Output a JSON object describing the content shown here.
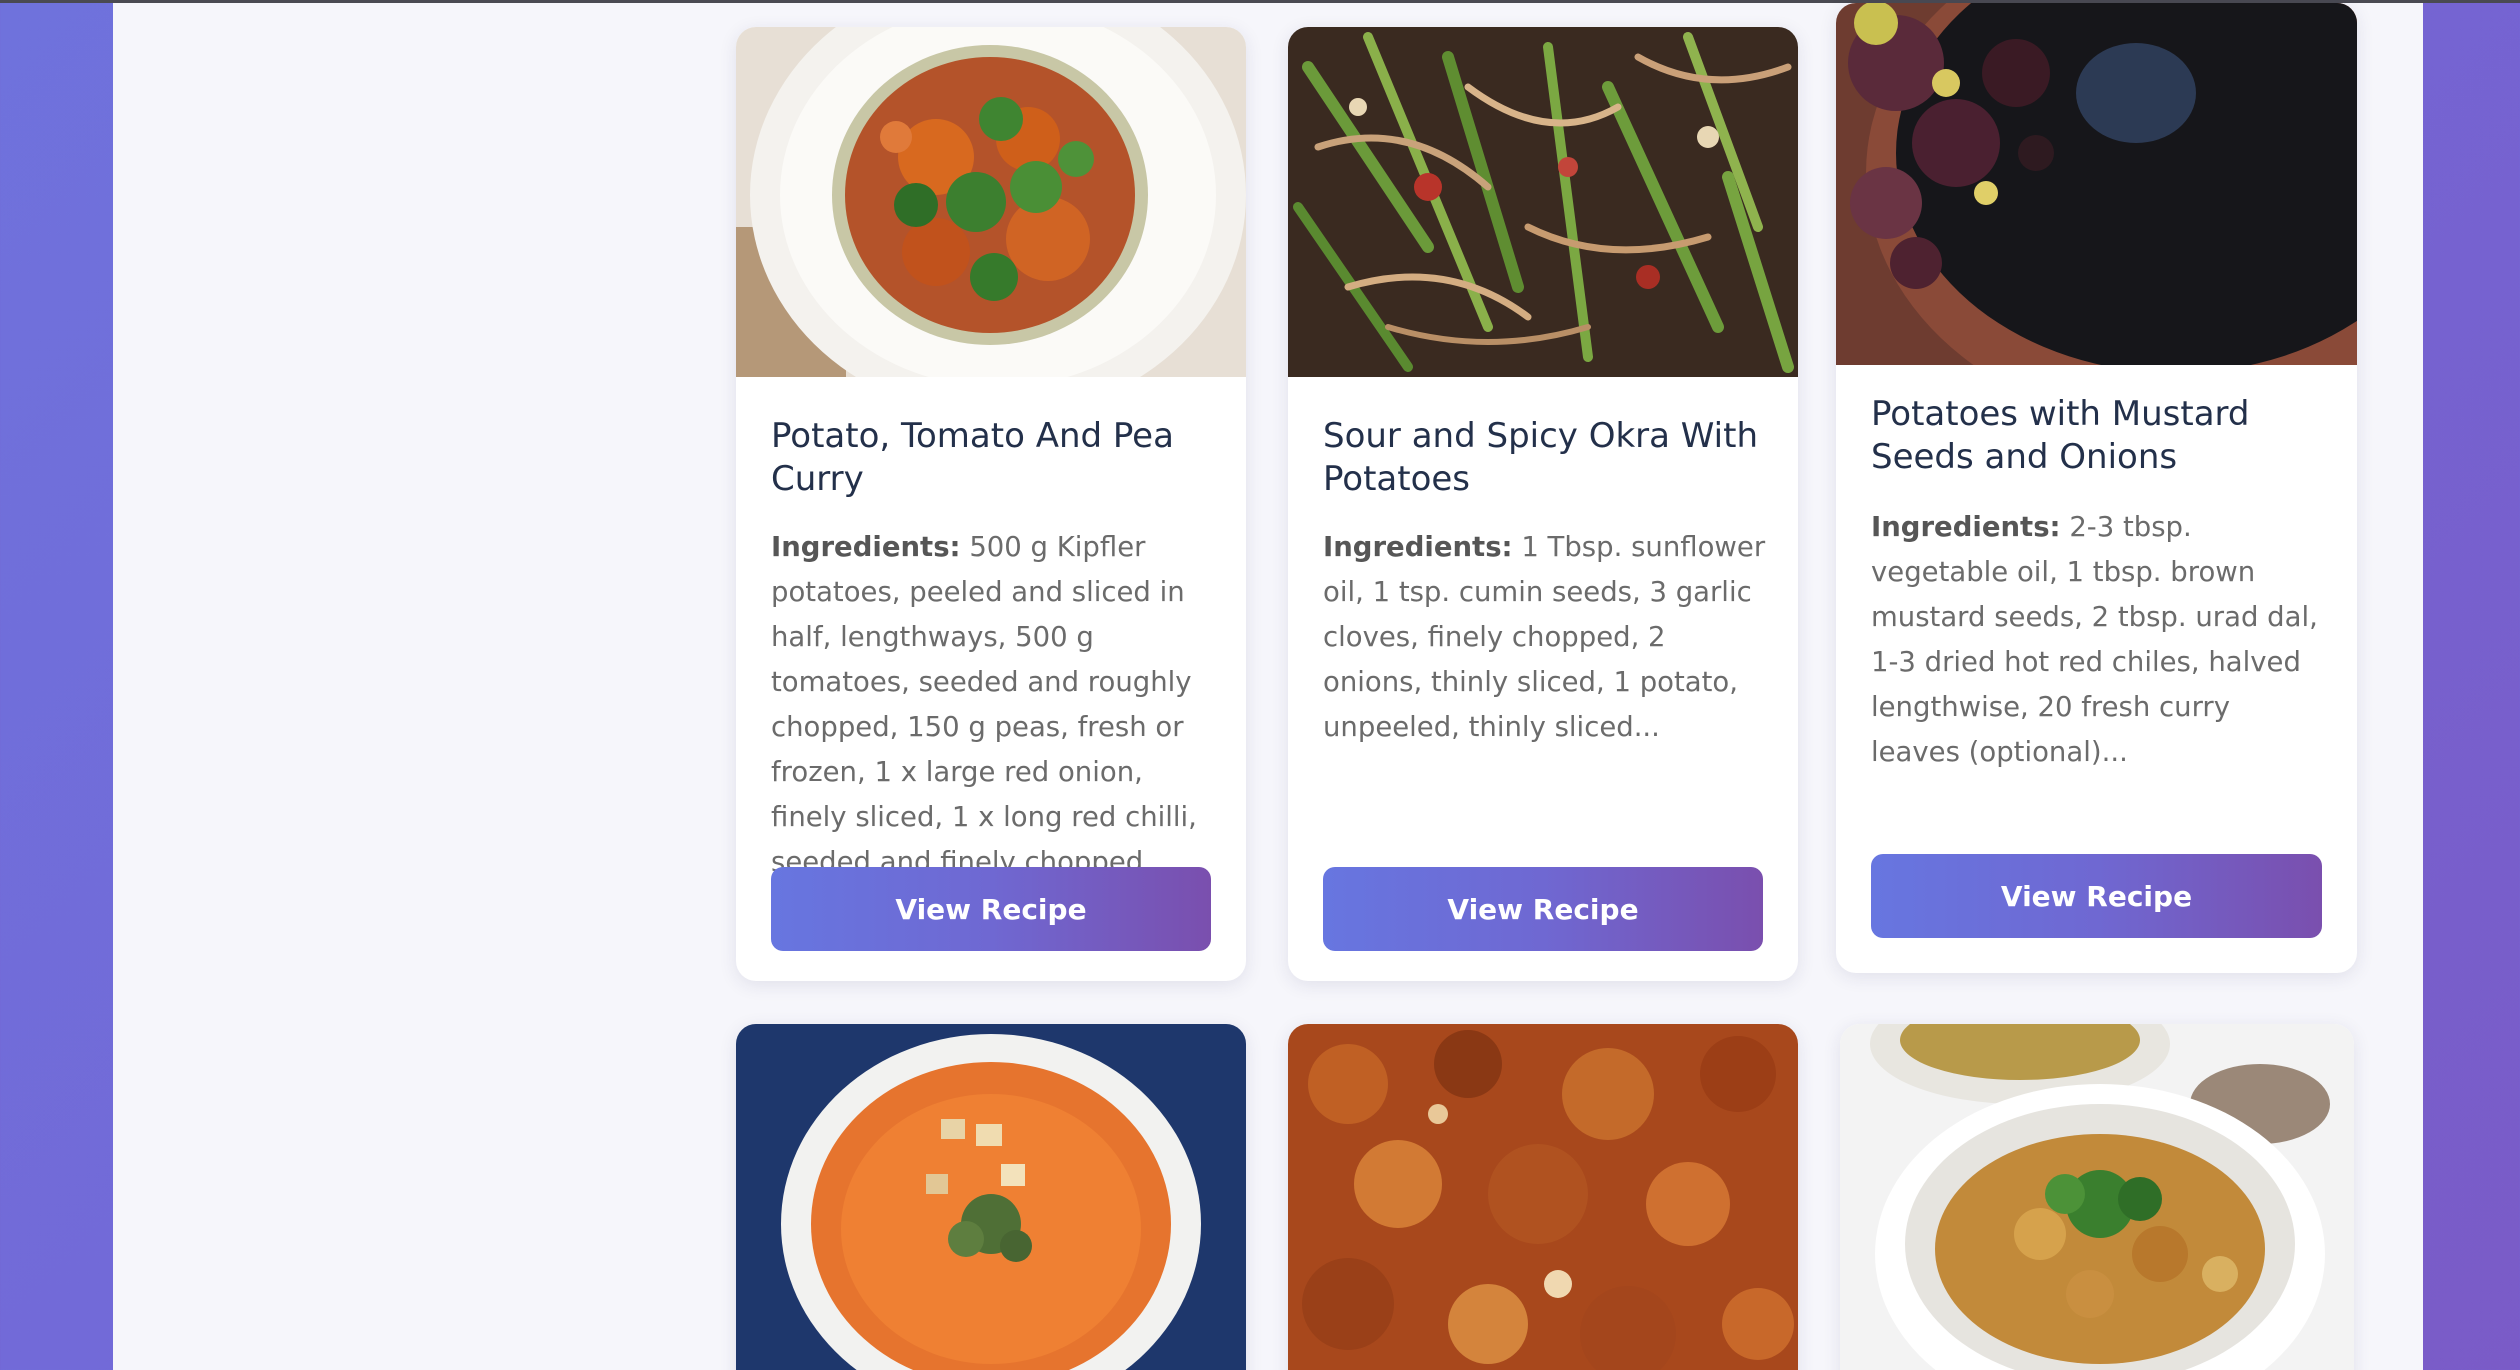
{
  "colors": {
    "page_gradient_start": "#6f72dc",
    "page_gradient_end": "#7a5bc7",
    "content_background": "#f6f6fb",
    "card_background": "#ffffff",
    "title_color": "#23304a",
    "text_color": "#6b6b6b",
    "button_gradient_start": "#6776e0",
    "button_gradient_end": "#7a4fae",
    "button_text": "#ffffff"
  },
  "recipes": [
    {
      "title": "Potato, Tomato And Pea Curry",
      "ingredients_label": "Ingredients:",
      "ingredients_text": "500 g Kipfler potatoes, peeled and sliced in half, lengthways, 500 g tomatoes, seeded and roughly chopped, 150 g peas, fresh or frozen, 1 x large red onion, finely sliced, 1 x long red chilli, seeded and finely chopped...",
      "button_label": "View Recipe",
      "image_icon": "curry-bowl-photo"
    },
    {
      "title": "Sour and Spicy Okra With Potatoes",
      "ingredients_label": "Ingredients:",
      "ingredients_text": "1 Tbsp. sunflower oil, 1 tsp. cumin seeds, 3 garlic cloves, finely chopped, 2 onions, thinly sliced, 1 potato, unpeeled, thinly sliced...",
      "button_label": "View Recipe",
      "image_icon": "okra-stirfry-photo"
    },
    {
      "title": "Potatoes with Mustard Seeds and Onions",
      "ingredients_label": "Ingredients:",
      "ingredients_text": "2-3 tbsp. vegetable oil, 1 tbsp. brown mustard seeds, 2 tbsp. urad dal, 1-3 dried hot red chiles, halved lengthwise, 20 fresh curry leaves (optional)...",
      "button_label": "View Recipe",
      "image_icon": "potato-pan-photo"
    },
    {
      "image_icon": "tomato-soup-photo"
    },
    {
      "image_icon": "baked-dish-photo"
    },
    {
      "image_icon": "chickpea-curry-photo"
    }
  ]
}
